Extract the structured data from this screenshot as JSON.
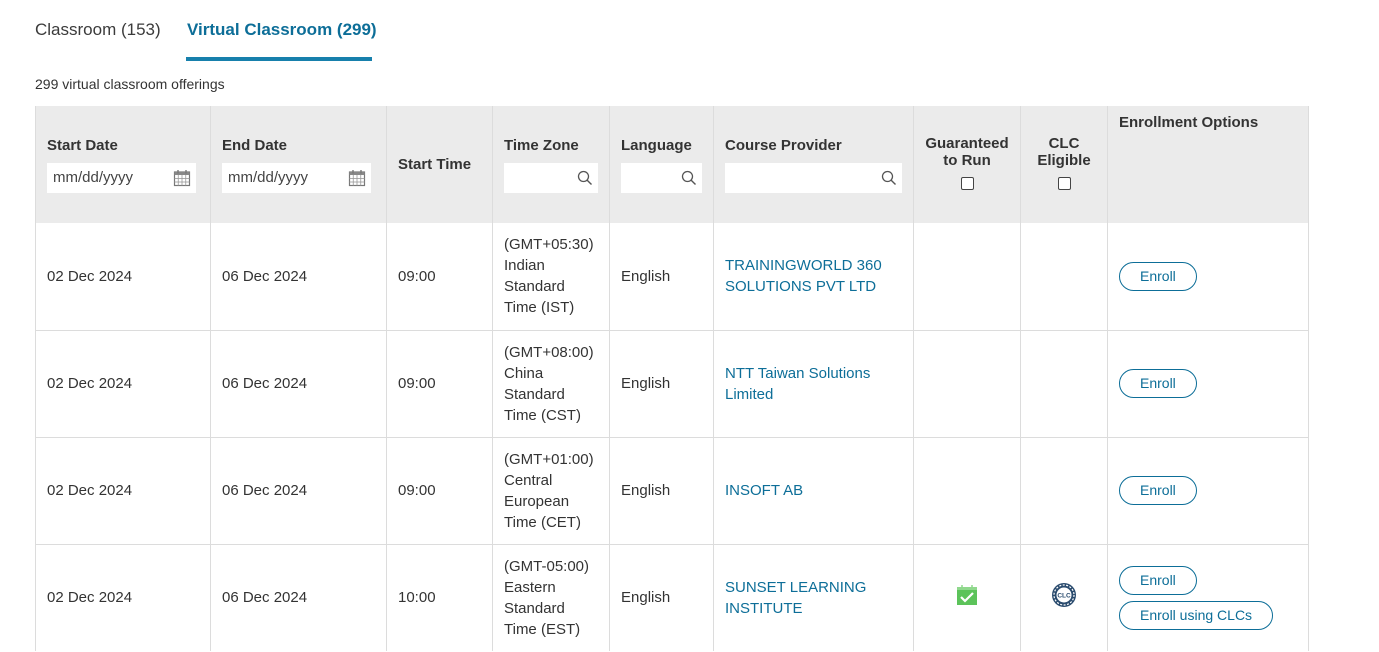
{
  "tabs": [
    {
      "label": "Classroom (153)",
      "active": false
    },
    {
      "label": "Virtual Classroom (299)",
      "active": true
    }
  ],
  "offering_count": "299 virtual classroom offerings",
  "table": {
    "headers": {
      "start_date": "Start Date",
      "end_date": "End Date",
      "start_time": "Start Time",
      "time_zone": "Time Zone",
      "language": "Language",
      "course_provider": "Course Provider",
      "guaranteed": "Guaranteed to Run",
      "clc": "CLC Eligible",
      "enrollment": "Enrollment Options"
    },
    "filters": {
      "start_date_placeholder": "mm/dd/yyyy",
      "end_date_placeholder": "mm/dd/yyyy"
    },
    "rows": [
      {
        "start_date": "02 Dec 2024",
        "end_date": "06 Dec 2024",
        "start_time": "09:00",
        "tz_1": "(GMT+05:30)",
        "tz_2": "Indian",
        "tz_3": "Standard",
        "tz_4": "Time (IST)",
        "language": "English",
        "provider_1": "TRAININGWORLD 360",
        "provider_2": "SOLUTIONS PVT LTD",
        "guaranteed": false,
        "clc": false,
        "enroll_label": "Enroll"
      },
      {
        "start_date": "02 Dec 2024",
        "end_date": "06 Dec 2024",
        "start_time": "09:00",
        "tz_1": "(GMT+08:00)",
        "tz_2": "China",
        "tz_3": "Standard",
        "tz_4": "Time (CST)",
        "language": "English",
        "provider_1": "NTT Taiwan Solutions",
        "provider_2": "Limited",
        "guaranteed": false,
        "clc": false,
        "enroll_label": "Enroll"
      },
      {
        "start_date": "02 Dec 2024",
        "end_date": "06 Dec 2024",
        "start_time": "09:00",
        "tz_1": "(GMT+01:00)",
        "tz_2": "Central",
        "tz_3": "European",
        "tz_4": "Time (CET)",
        "language": "English",
        "provider_1": "INSOFT AB",
        "provider_2": "",
        "guaranteed": false,
        "clc": false,
        "enroll_label": "Enroll"
      },
      {
        "start_date": "02 Dec 2024",
        "end_date": "06 Dec 2024",
        "start_time": "10:00",
        "tz_1": "(GMT-05:00)",
        "tz_2": "Eastern",
        "tz_3": "Standard",
        "tz_4": "Time (EST)",
        "language": "English",
        "provider_1": "SUNSET LEARNING",
        "provider_2": "INSTITUTE",
        "guaranteed": true,
        "clc": true,
        "clc_badge_text": "CLC",
        "enroll_label": "Enroll",
        "enroll_clc_label": "Enroll using CLCs"
      }
    ]
  },
  "colors": {
    "accent": "#0d6e98",
    "header_bg": "#ebebeb",
    "guaranteed_icon": "#5cc35a"
  }
}
